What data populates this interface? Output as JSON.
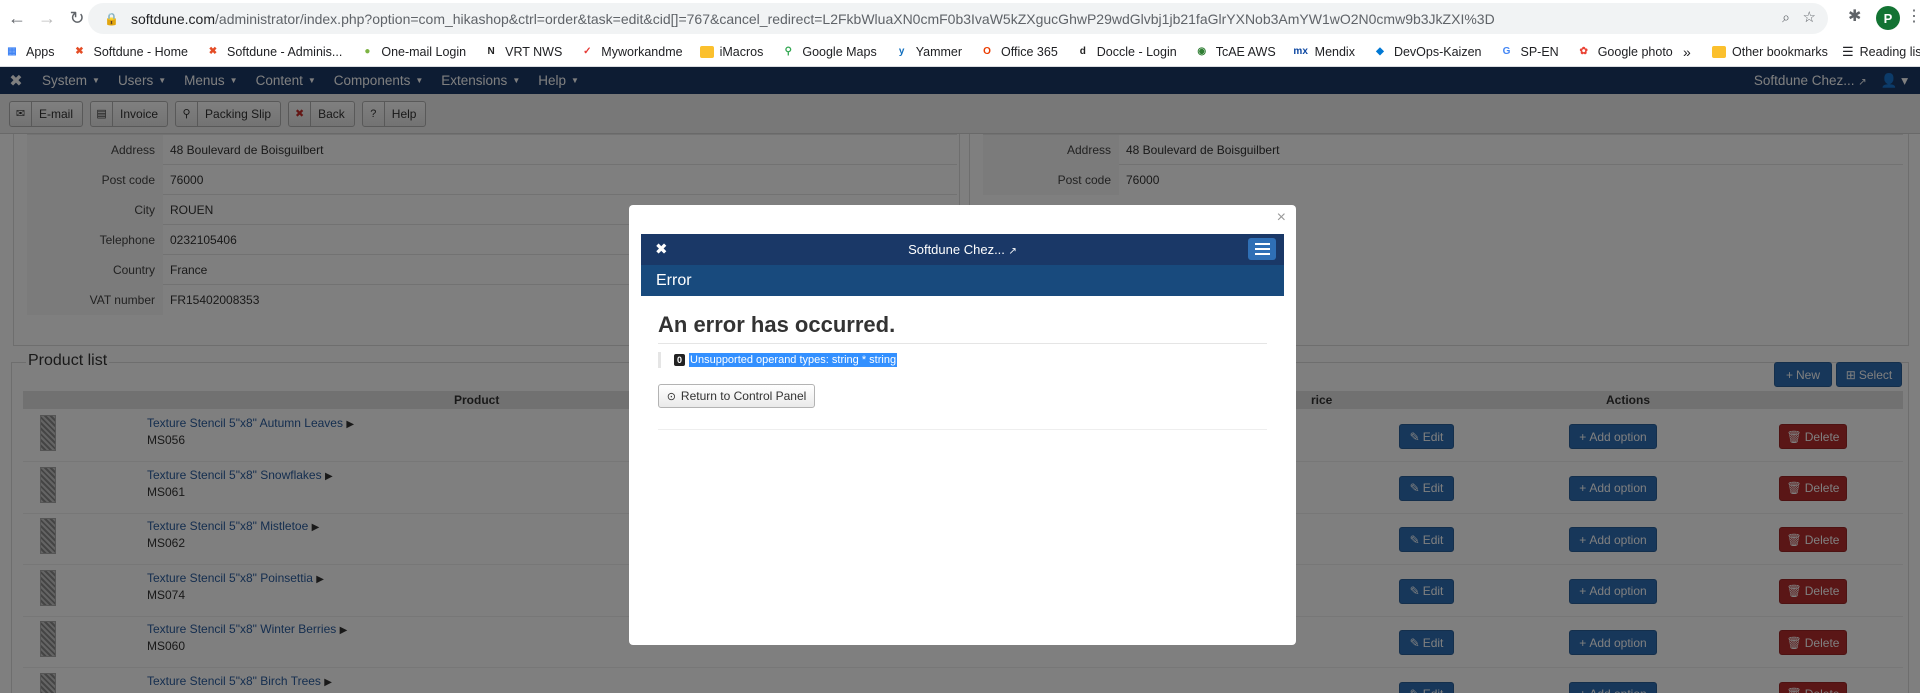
{
  "browser": {
    "url_host": "softdune.com",
    "url_path": "/administrator/index.php?option=com_hikashop&ctrl=order&task=edit&cid[]=767&cancel_redirect=L2FkbWluaXN0cmF0b3IvaW5kZXgucGhwP29wdGlvbj1jb21faGlrYXNob3AmYW1wO2N0cmw9b3JkZXI%3D",
    "profile_initial": "P",
    "bookmarks": [
      {
        "label": "Apps",
        "icon": "apps-grid-icon",
        "color": "#4285f4"
      },
      {
        "label": "Softdune - Home",
        "icon": "joomla-icon",
        "color": "#e44d26"
      },
      {
        "label": "Softdune - Adminis...",
        "icon": "joomla-icon",
        "color": "#e44d26"
      },
      {
        "label": "One-mail Login",
        "icon": "circle-icon",
        "color": "#7cb342"
      },
      {
        "label": "VRT NWS",
        "icon": "vrt-icon",
        "color": "#222222"
      },
      {
        "label": "Myworkandme",
        "icon": "check-icon",
        "color": "#e53935"
      },
      {
        "label": "iMacros",
        "icon": "folder-icon",
        "color": "#fbc02d"
      },
      {
        "label": "Google Maps",
        "icon": "map-pin-icon",
        "color": "#34a853"
      },
      {
        "label": "Yammer",
        "icon": "yammer-icon",
        "color": "#106ebe"
      },
      {
        "label": "Office 365",
        "icon": "office-icon",
        "color": "#eb3c00"
      },
      {
        "label": "Doccle - Login",
        "icon": "doccle-icon",
        "color": "#222222"
      },
      {
        "label": "TcAE AWS",
        "icon": "aws-icon",
        "color": "#2e7d32"
      },
      {
        "label": "Mendix",
        "icon": "mendix-icon",
        "color": "#0d47a1"
      },
      {
        "label": "DevOps-Kaizen",
        "icon": "devops-icon",
        "color": "#0078d4"
      },
      {
        "label": "SP-EN",
        "icon": "google-icon",
        "color": "#4285f4"
      },
      {
        "label": "Google photo",
        "icon": "photos-icon",
        "color": "#ea4335"
      }
    ],
    "more_bookmarks": "»",
    "other_bookmarks": "Other bookmarks",
    "reading_list": "Reading lis"
  },
  "admin": {
    "menu": [
      {
        "label": "System"
      },
      {
        "label": "Users"
      },
      {
        "label": "Menus"
      },
      {
        "label": "Content"
      },
      {
        "label": "Components"
      },
      {
        "label": "Extensions"
      },
      {
        "label": "Help"
      }
    ],
    "site_name": "Softdune Chez...",
    "toolbar": [
      {
        "label": "E-mail",
        "icon": "email-icon"
      },
      {
        "label": "Invoice",
        "icon": "invoice-icon"
      },
      {
        "label": "Packing Slip",
        "icon": "map-pin-icon"
      },
      {
        "label": "Back",
        "icon": "cancel-icon"
      },
      {
        "label": "Help",
        "icon": "help-icon"
      }
    ]
  },
  "address_left": [
    {
      "key": "Address",
      "value": "48 Boulevard de Boisguilbert"
    },
    {
      "key": "Post code",
      "value": "76000"
    },
    {
      "key": "City",
      "value": "ROUEN"
    },
    {
      "key": "Telephone",
      "value": "0232105406"
    },
    {
      "key": "Country",
      "value": "France"
    },
    {
      "key": "VAT number",
      "value": "FR15402008353"
    }
  ],
  "address_right": [
    {
      "key": "Address",
      "value": "48 Boulevard de Boisguilbert"
    },
    {
      "key": "Post code",
      "value": "76000"
    }
  ],
  "products": {
    "legend": "Product list",
    "new_label": "New",
    "select_label": "Select",
    "columns": {
      "product": "Product",
      "price": "rice",
      "actions": "Actions"
    },
    "edit_label": "Edit",
    "add_option_label": "Add option",
    "delete_label": "Delete",
    "rows": [
      {
        "name": "Texture Stencil 5\"x8\" Autumn Leaves",
        "code": "MS056"
      },
      {
        "name": "Texture Stencil 5\"x8\" Snowflakes",
        "code": "MS061"
      },
      {
        "name": "Texture Stencil 5\"x8\" Mistletoe",
        "code": "MS062"
      },
      {
        "name": "Texture Stencil 5\"x8\" Poinsettia",
        "code": "MS074"
      },
      {
        "name": "Texture Stencil 5\"x8\" Winter Berries",
        "code": "MS060"
      },
      {
        "name": "Texture Stencil 5\"x8\" Birch Trees",
        "code": ""
      }
    ]
  },
  "modal": {
    "close_symbol": "×",
    "site_name": "Softdune Chez...",
    "header": "Error",
    "title": "An error has occurred.",
    "error_code": "0",
    "error_message": "Unsupported operand types: string * string",
    "return_label": "Return to Control Panel"
  }
}
